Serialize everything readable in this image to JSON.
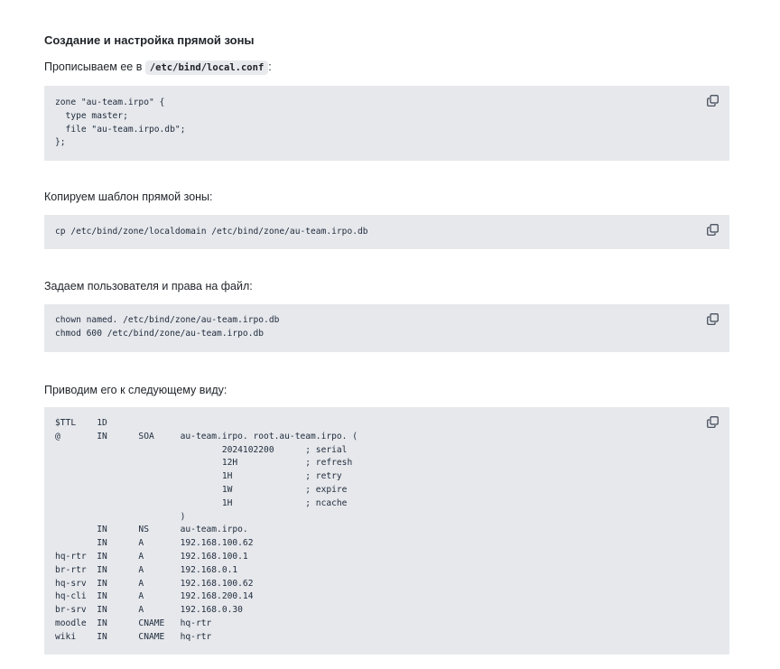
{
  "heading": "Создание и настройка прямой зоны",
  "step1": {
    "text_before": "Прописываем ее в ",
    "file": "/etc/bind/local.conf",
    "text_after": ":",
    "code": "zone \"au-team.irpo\" {\n  type master;\n  file \"au-team.irpo.db\";\n};"
  },
  "step2": {
    "text": "Копируем шаблон прямой зоны:",
    "code": "cp /etc/bind/zone/localdomain /etc/bind/zone/au-team.irpo.db"
  },
  "step3": {
    "text": "Задаем пользователя и права на файл:",
    "code": "chown named. /etc/bind/zone/au-team.irpo.db\nchmod 600 /etc/bind/zone/au-team.irpo.db"
  },
  "step4": {
    "text": "Приводим его к следующему виду:",
    "code": "$TTL    1D\n@       IN      SOA     au-team.irpo. root.au-team.irpo. (\n                                2024102200      ; serial\n                                12H             ; refresh\n                                1H              ; retry\n                                1W              ; expire\n                                1H              ; ncache\n                        )\n        IN      NS      au-team.irpo.\n        IN      A       192.168.100.62\nhq-rtr  IN      A       192.168.100.1\nbr-rtr  IN      A       192.168.0.1\nhq-srv  IN      A       192.168.100.62\nhq-cli  IN      A       192.168.200.14\nbr-srv  IN      A       192.168.0.30\nmoodle  IN      CNAME   hq-rtr\nwiki    IN      CNAME   hq-rtr"
  },
  "icons": {
    "copy": "copy-icon"
  }
}
